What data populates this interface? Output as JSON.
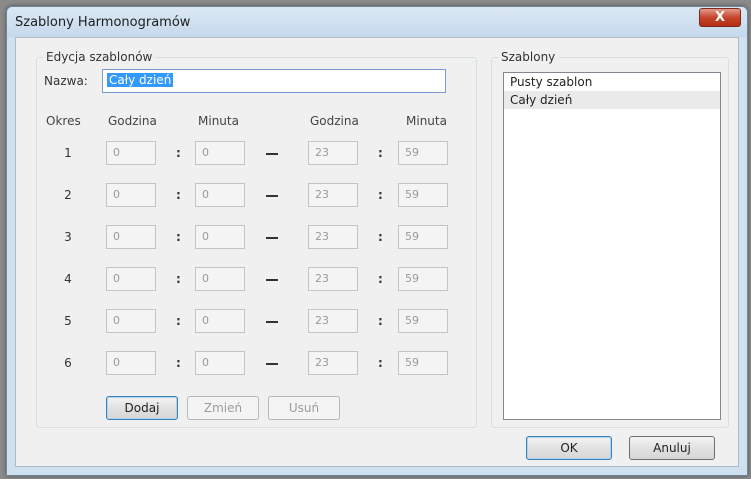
{
  "window": {
    "title": "Szablony Harmonogramów",
    "close_label": "X"
  },
  "edit_group": {
    "legend": "Edycja szablonów",
    "name_label": "Nazwa:",
    "name_value": "Cały dzień",
    "headers": {
      "period": "Okres",
      "start_hour": "Godzina",
      "start_minute": "Minuta",
      "end_hour": "Godzina",
      "end_minute": "Minuta"
    },
    "rows": [
      {
        "num": "1",
        "start_hour": "0",
        "start_minute": "0",
        "end_hour": "23",
        "end_minute": "59"
      },
      {
        "num": "2",
        "start_hour": "0",
        "start_minute": "0",
        "end_hour": "23",
        "end_minute": "59"
      },
      {
        "num": "3",
        "start_hour": "0",
        "start_minute": "0",
        "end_hour": "23",
        "end_minute": "59"
      },
      {
        "num": "4",
        "start_hour": "0",
        "start_minute": "0",
        "end_hour": "23",
        "end_minute": "59"
      },
      {
        "num": "5",
        "start_hour": "0",
        "start_minute": "0",
        "end_hour": "23",
        "end_minute": "59"
      },
      {
        "num": "6",
        "start_hour": "0",
        "start_minute": "0",
        "end_hour": "23",
        "end_minute": "59"
      }
    ],
    "buttons": {
      "add": "Dodaj",
      "change": "Zmień",
      "delete": "Usuń"
    }
  },
  "templates_group": {
    "legend": "Szablony",
    "items": [
      "Pusty szablon",
      "Cały dzień"
    ],
    "selected_index": 1
  },
  "footer": {
    "ok": "OK",
    "cancel": "Anuluj"
  }
}
